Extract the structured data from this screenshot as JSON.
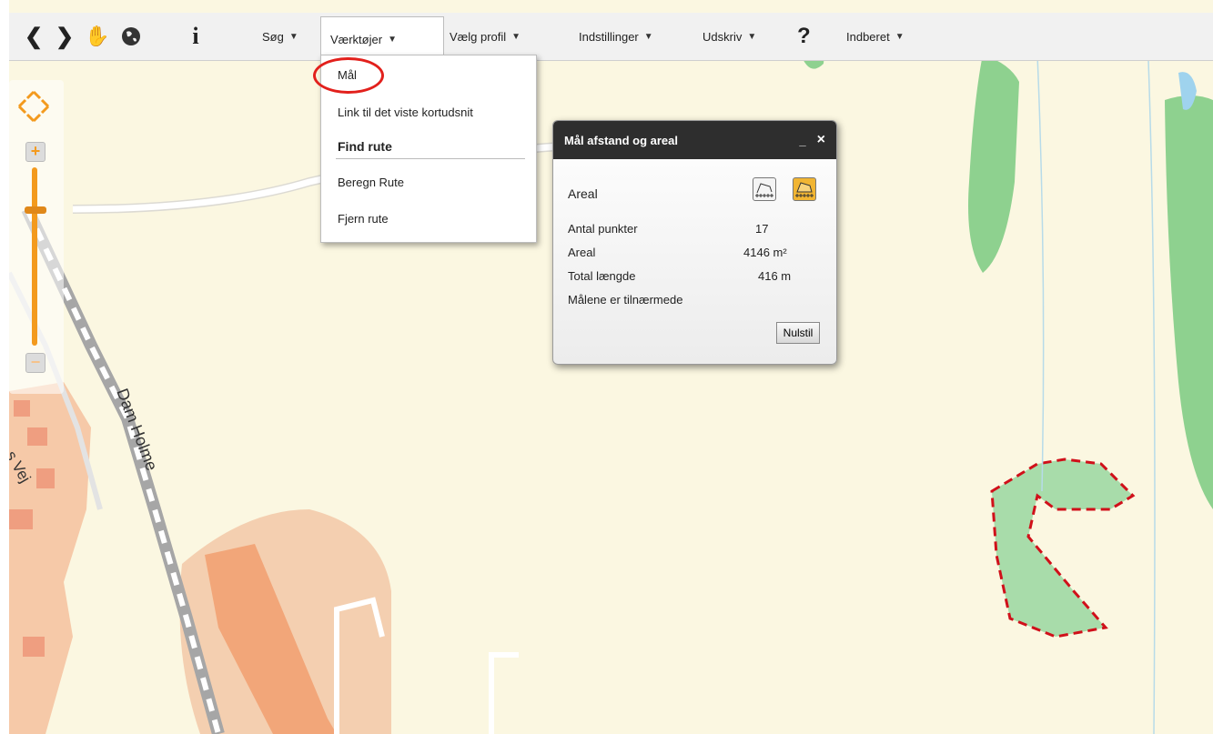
{
  "toolbar": {
    "nav": [
      {
        "name": "back-icon",
        "glyph": "❮"
      },
      {
        "name": "forward-icon",
        "glyph": "❯"
      },
      {
        "name": "pan-hand-icon",
        "glyph": "✋"
      },
      {
        "name": "globe-icon",
        "glyph": "●"
      },
      {
        "name": "info-icon",
        "glyph": "i"
      }
    ],
    "menus": {
      "search": "Søg",
      "tools": "Værktøjer",
      "profile": "Vælg profil",
      "settings": "Indstillinger",
      "print": "Udskriv",
      "help": "?",
      "report": "Indberet"
    },
    "caret": "▼"
  },
  "tools_dropdown": {
    "measure": "Mål",
    "link": "Link til det viste kortudsnit",
    "route_heading": "Find rute",
    "calc_route": "Beregn Rute",
    "remove_route": "Fjern rute"
  },
  "measure_panel": {
    "title": "Mål afstand og areal",
    "minimize": "_",
    "close": "×",
    "mode_label": "Areal",
    "rows": [
      {
        "label": "Antal punkter",
        "value": "17"
      },
      {
        "label": "Areal",
        "value": "4146 m²"
      },
      {
        "label": "Total længde",
        "value": "416 m"
      }
    ],
    "note": "Målene er tilnærmede",
    "reset": "Nulstil"
  },
  "zoom": {
    "in": "+",
    "out": "−",
    "level": 0.76
  },
  "map": {
    "labels": {
      "road_main": "Dam Holme",
      "road_side": "s Vej"
    }
  },
  "colors": {
    "accent": "#f39a1e",
    "highlight": "#e2201c",
    "measure_line": "#d0101a"
  }
}
